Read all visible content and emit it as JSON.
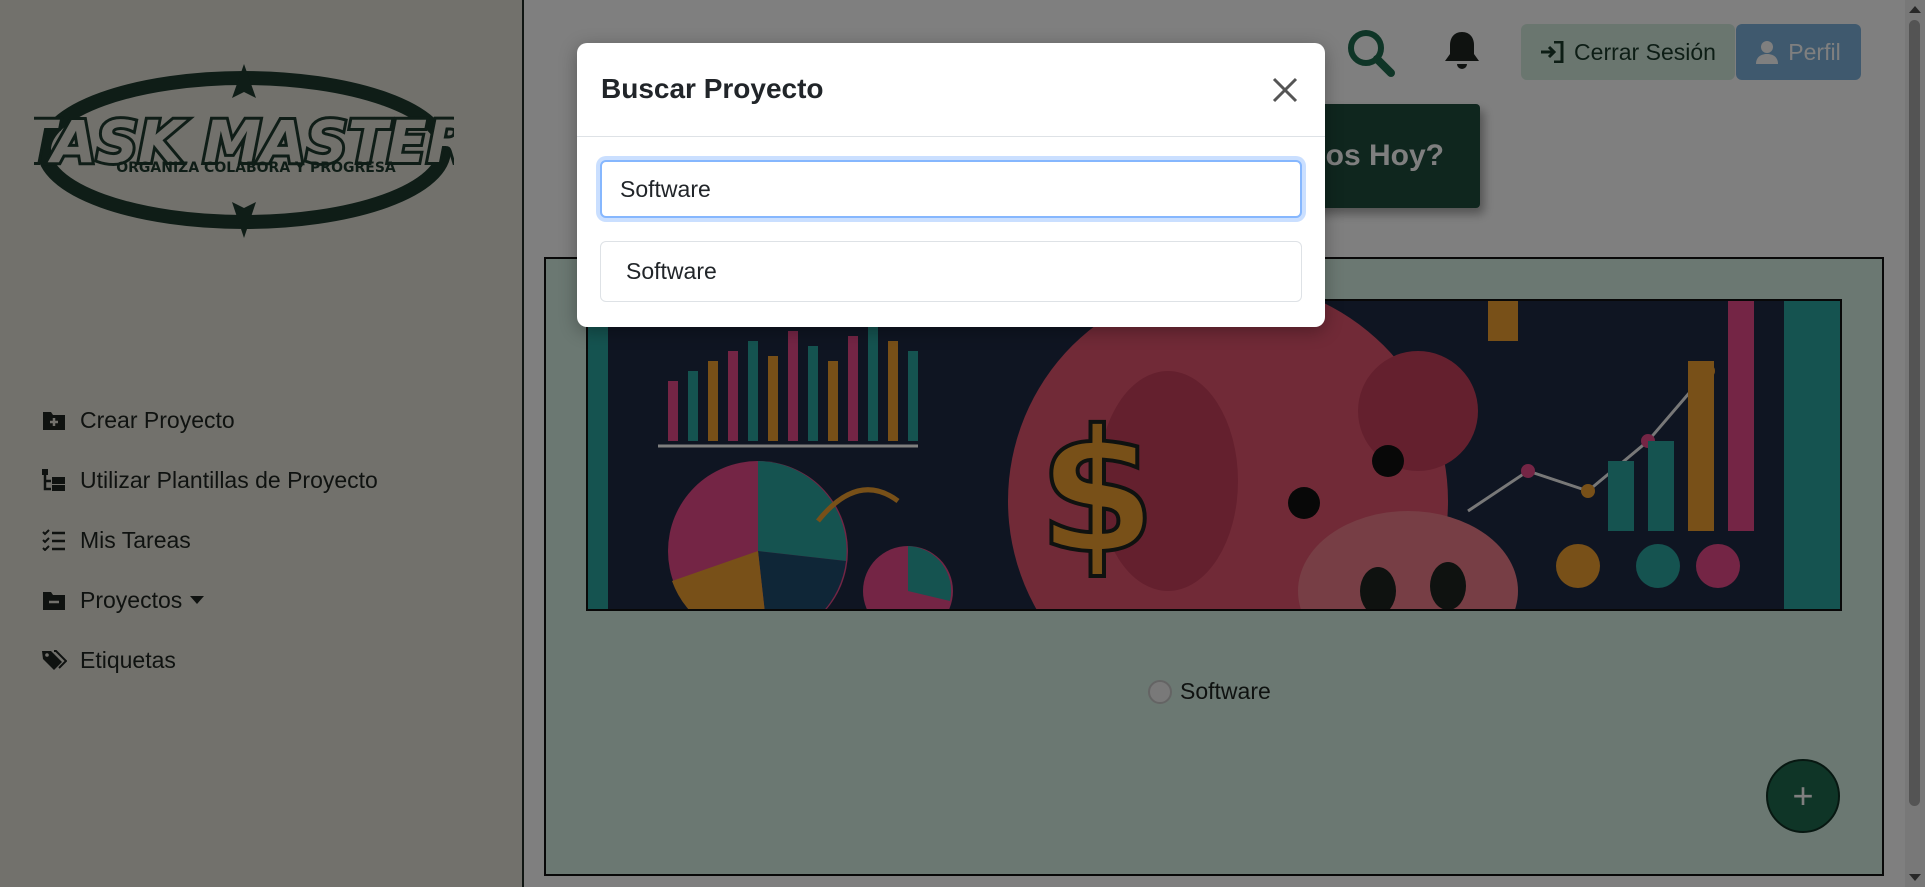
{
  "sidebar": {
    "logo": {
      "title": "TASK MASTER",
      "tagline": "ORGANIZA COLABORA Y PROGRESA"
    },
    "items": [
      {
        "label": "Crear Proyecto",
        "icon": "folder-plus-icon"
      },
      {
        "label": "Utilizar Plantillas de Proyecto",
        "icon": "template-icon"
      },
      {
        "label": "Mis Tareas",
        "icon": "task-list-icon"
      },
      {
        "label": "Proyectos",
        "icon": "folder-minus-icon"
      },
      {
        "label": "Etiquetas",
        "icon": "tags-icon"
      }
    ]
  },
  "header": {
    "logout_label": "Cerrar Sesión",
    "profile_label": "Perfil",
    "greeting_visible_text": "os Hoy?"
  },
  "main": {
    "project_name": "Software",
    "add_label": "+"
  },
  "modal": {
    "title": "Buscar Proyecto",
    "search_value": "Software",
    "results": [
      "Software"
    ]
  },
  "colors": {
    "accent_dark_green": "#1f4d3d",
    "fab_green": "#1f6b4e",
    "panel_mint": "#d6f0e4",
    "logout_bg": "#d5ecdf",
    "profile_bg": "#7fb3dc",
    "input_focus": "#86b7fe"
  }
}
